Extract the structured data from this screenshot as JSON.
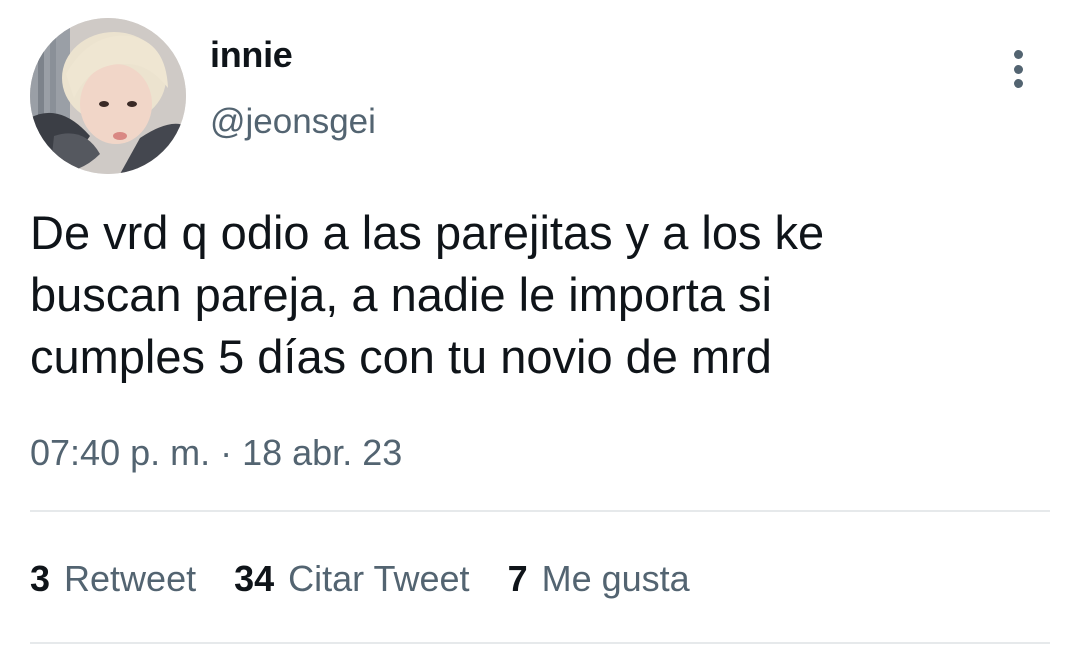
{
  "tweet": {
    "author": {
      "display_name": "innie",
      "handle": "@jeonsgei"
    },
    "text_lines": [
      "De vrd q odio a las parejitas y a los ke",
      "buscan pareja, a nadie le importa si",
      "cumples 5 días con tu novio de mrd"
    ],
    "timestamp": "07:40 p. m. · 18 abr. 23",
    "stats": [
      {
        "count": "3",
        "label": "Retweet"
      },
      {
        "count": "34",
        "label": "Citar Tweet"
      },
      {
        "count": "7",
        "label": "Me gusta"
      }
    ],
    "more_icon": "more-vertical-icon"
  },
  "colors": {
    "text_primary": "#0f1419",
    "text_secondary": "#536471",
    "divider": "#e6e9eb",
    "background": "#ffffff"
  }
}
